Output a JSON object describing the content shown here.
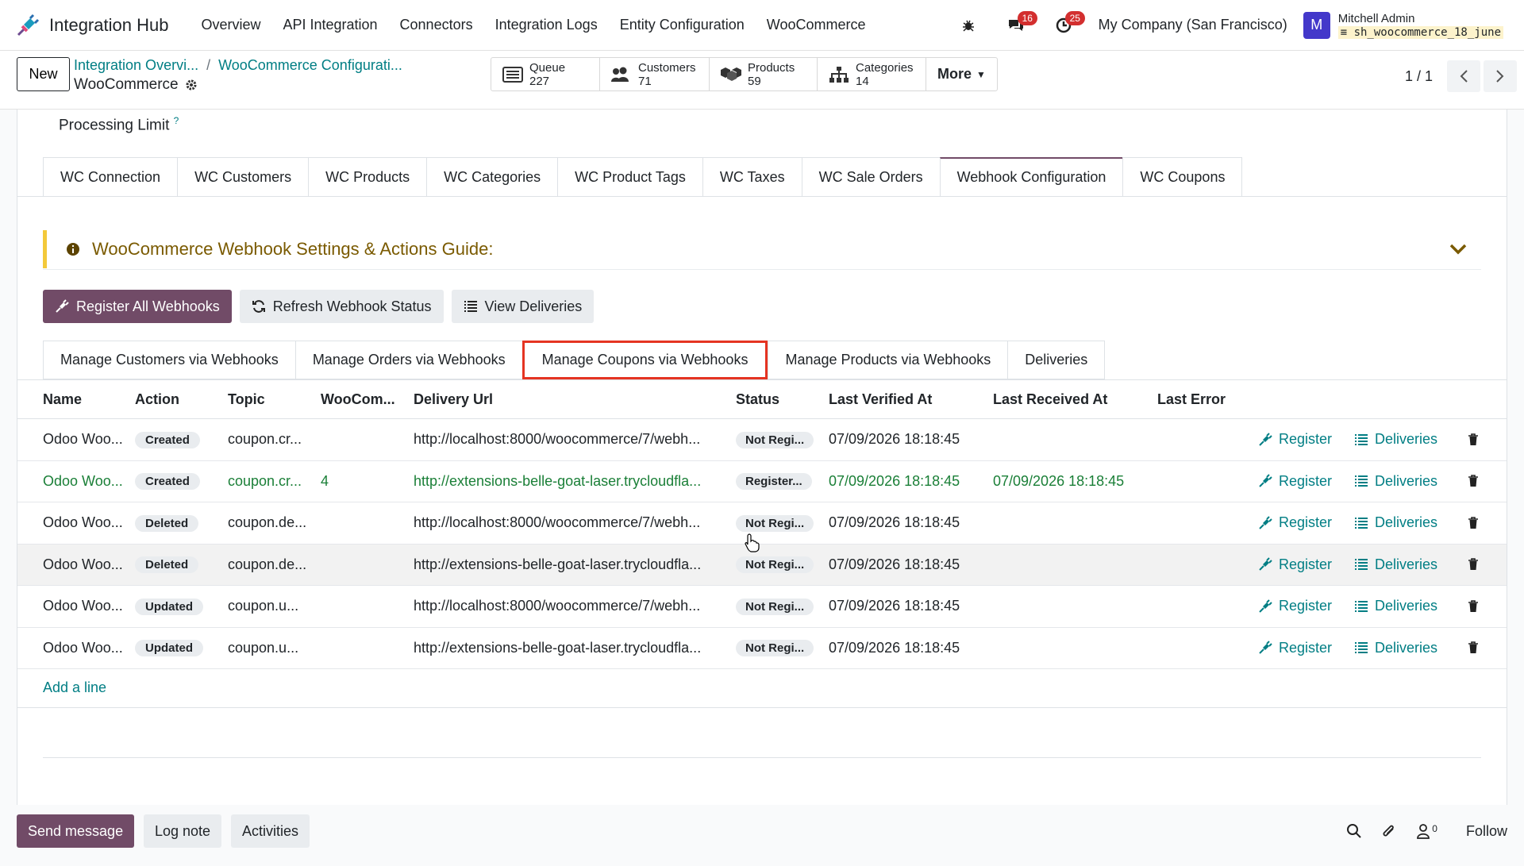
{
  "navbar": {
    "brand": "Integration Hub",
    "menu": [
      "Overview",
      "API Integration",
      "Connectors",
      "Integration Logs",
      "Entity Configuration",
      "WooCommerce"
    ],
    "messages_badge": "16",
    "activities_badge": "25",
    "company": "My Company (San Francisco)",
    "avatar_letter": "M",
    "user_name": "Mitchell Admin",
    "user_db": "sh_woocommerce_18_june"
  },
  "control": {
    "new_label": "New",
    "breadcrumb_1": "Integration Overvi...",
    "breadcrumb_2": "WooCommerce Configurati...",
    "breadcrumb_sep": "/",
    "record_title": "WooCommerce",
    "stats": [
      {
        "label": "Queue",
        "value": "227",
        "icon": "queue-icon"
      },
      {
        "label": "Customers",
        "value": "71",
        "icon": "customers-icon"
      },
      {
        "label": "Products",
        "value": "59",
        "icon": "products-icon"
      },
      {
        "label": "Categories",
        "value": "14",
        "icon": "categories-icon"
      }
    ],
    "more_label": "More",
    "pager": "1 / 1"
  },
  "form": {
    "processing_limit_label": "Processing Limit",
    "processing_limit_help": "?",
    "tabs": [
      "WC Connection",
      "WC Customers",
      "WC Products",
      "WC Categories",
      "WC Product Tags",
      "WC Taxes",
      "WC Sale Orders",
      "Webhook Configuration",
      "WC Coupons"
    ],
    "active_tab": "Webhook Configuration",
    "guide_title": "WooCommerce Webhook Settings & Actions Guide:",
    "actions": {
      "register_all": "Register All Webhooks",
      "refresh_status": "Refresh Webhook Status",
      "view_deliveries": "View Deliveries"
    },
    "subtabs": [
      "Manage Customers via Webhooks",
      "Manage Orders via Webhooks",
      "Manage Coupons via Webhooks",
      "Manage Products via Webhooks",
      "Deliveries"
    ],
    "active_subtab": "Manage Coupons via Webhooks"
  },
  "table": {
    "columns": [
      "Name",
      "Action",
      "Topic",
      "WooCom...",
      "Delivery Url",
      "Status",
      "Last Verified At",
      "Last Received At",
      "Last Error"
    ],
    "register_label": "Register",
    "deliveries_label": "Deliveries",
    "rows": [
      {
        "name": "Odoo Woo...",
        "action": "Created",
        "topic": "coupon.cr...",
        "woo": "",
        "url": "http://localhost:8000/woocommerce/7/webh...",
        "status": "Not Regi...",
        "verified": "07/09/2026 18:18:45",
        "received": "",
        "error": ""
      },
      {
        "name": "Odoo Woo...",
        "action": "Created",
        "topic": "coupon.cr...",
        "woo": "4",
        "url": "http://extensions-belle-goat-laser.trycloudfla...",
        "status": "Register...",
        "verified": "07/09/2026 18:18:45",
        "received": "07/09/2026 18:18:45",
        "error": ""
      },
      {
        "name": "Odoo Woo...",
        "action": "Deleted",
        "topic": "coupon.de...",
        "woo": "",
        "url": "http://localhost:8000/woocommerce/7/webh...",
        "status": "Not Regi...",
        "verified": "07/09/2026 18:18:45",
        "received": "",
        "error": ""
      },
      {
        "name": "Odoo Woo...",
        "action": "Deleted",
        "topic": "coupon.de...",
        "woo": "",
        "url": "http://extensions-belle-goat-laser.trycloudfla...",
        "status": "Not Regi...",
        "verified": "07/09/2026 18:18:45",
        "received": "",
        "error": ""
      },
      {
        "name": "Odoo Woo...",
        "action": "Updated",
        "topic": "coupon.u...",
        "woo": "",
        "url": "http://localhost:8000/woocommerce/7/webh...",
        "status": "Not Regi...",
        "verified": "07/09/2026 18:18:45",
        "received": "",
        "error": ""
      },
      {
        "name": "Odoo Woo...",
        "action": "Updated",
        "topic": "coupon.u...",
        "woo": "",
        "url": "http://extensions-belle-goat-laser.trycloudfla...",
        "status": "Not Regi...",
        "verified": "07/09/2026 18:18:45",
        "received": "",
        "error": ""
      }
    ],
    "add_line": "Add a line"
  },
  "chatter": {
    "send_message": "Send message",
    "log_note": "Log note",
    "activities": "Activities",
    "followers_count": "0",
    "follow": "Follow"
  },
  "colors": {
    "primary": "#714b67",
    "link": "#017e84",
    "highlight_box": "#e53422",
    "registered_row": "#1a7f37",
    "badge": "#d32f2f"
  }
}
